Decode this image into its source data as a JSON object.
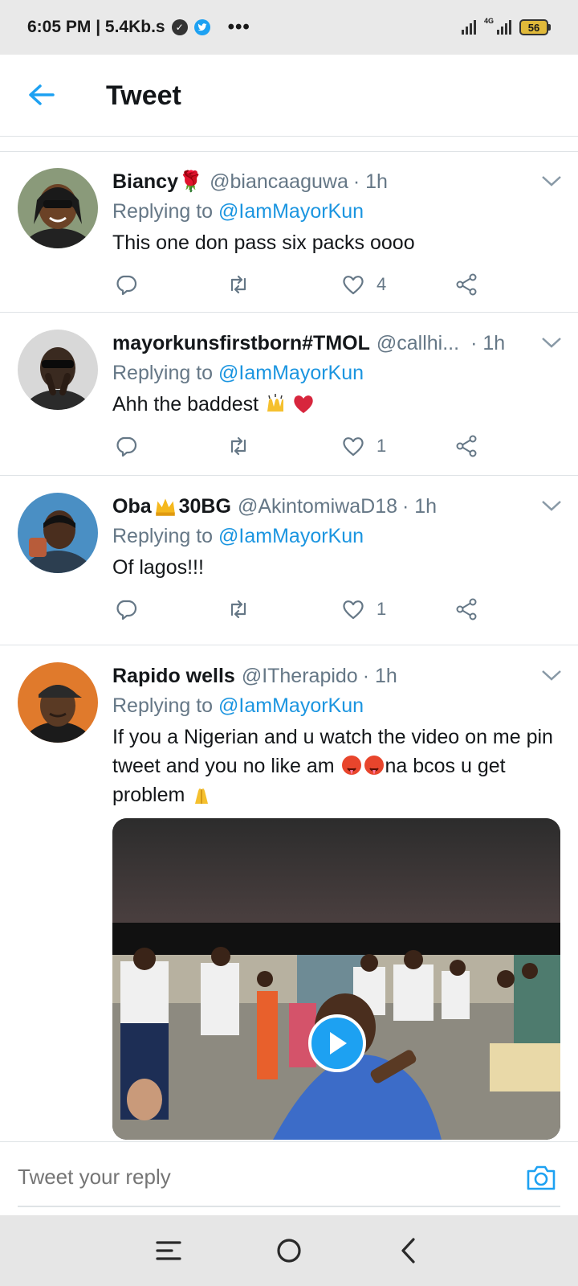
{
  "status_bar": {
    "time_speed": "6:05 PM | 5.4Kb.s",
    "more": "•••",
    "network": "4G",
    "battery": "56"
  },
  "header": {
    "title": "Tweet"
  },
  "tweets": [
    {
      "name": "Biancy🌹",
      "handle": "@biancaaguwa",
      "time": "· 1h",
      "replying_prefix": "Replying to ",
      "mention": "@IamMayorKun",
      "text": "This one don pass six packs oooo",
      "likes": "4"
    },
    {
      "name": "mayorkunsfirstborn#TMOL",
      "handle": "@callhi...",
      "time": "· 1h",
      "replying_prefix": "Replying to ",
      "mention": "@IamMayorKun",
      "text": "Ahh the baddest ",
      "likes": "1"
    },
    {
      "name": "Oba",
      "name2": " 30BG",
      "handle": "@AkintomiwaD18",
      "time": "· 1h",
      "replying_prefix": "Replying to ",
      "mention": "@IamMayorKun",
      "text": "Of lagos!!!",
      "likes": "1"
    },
    {
      "name": "Rapido wells",
      "handle": "@ITherapido",
      "time": "· 1h",
      "replying_prefix": "Replying to ",
      "mention": "@IamMayorKun",
      "text_a": "If you a Nigerian and u watch the video on me pin tweet and you no like am ",
      "text_b": "na bcos u get problem "
    }
  ],
  "reply_bar": {
    "placeholder": "Tweet your reply"
  },
  "colors": {
    "accent": "#1da1f2",
    "muted": "#657786",
    "text": "#14171a"
  }
}
